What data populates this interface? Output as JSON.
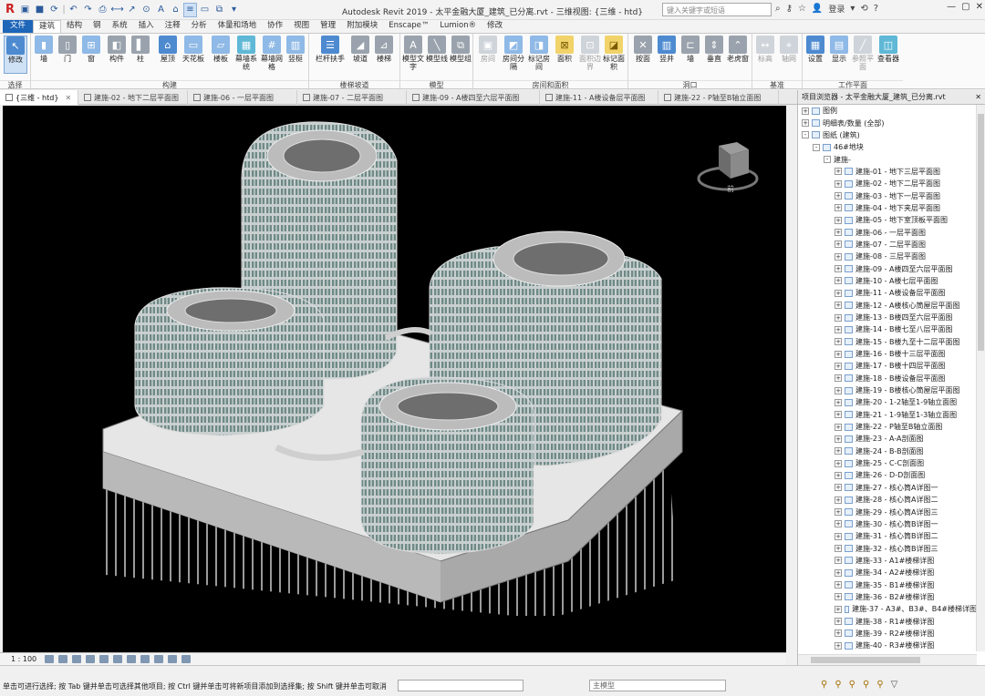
{
  "app": {
    "logo": "R",
    "window_title": "Autodesk Revit 2019 - 太平金融大厦_建筑_已分离.rvt - 三维视图: {三维 - htd}",
    "search_placeholder": "键入关键字或短语",
    "login": "登录"
  },
  "ribbon_tabs": [
    "文件",
    "建筑",
    "结构",
    "钢",
    "系统",
    "插入",
    "注释",
    "分析",
    "体量和场地",
    "协作",
    "视图",
    "管理",
    "附加模块",
    "Enscape™",
    "Lumion®",
    "修改"
  ],
  "ribbon": {
    "modify": "修改",
    "select": "选择",
    "build": {
      "label": "构建",
      "items": [
        "墙",
        "门",
        "窗",
        "构件",
        "柱",
        "屋顶",
        "天花板",
        "楼板",
        "幕墙系统",
        "幕墙网格",
        "竖梃"
      ]
    },
    "circulation": {
      "label": "楼梯坡道",
      "items": [
        "栏杆扶手",
        "坡道",
        "楼梯"
      ]
    },
    "model": {
      "label": "模型",
      "items": [
        "模型文字",
        "模型线",
        "模型组"
      ]
    },
    "room": {
      "label": "房间和面积",
      "items": [
        "房间",
        "房间分隔",
        "标记房间",
        "面积",
        "面积边界",
        "标记面积"
      ]
    },
    "opening": {
      "label": "洞口",
      "items": [
        "按面",
        "竖井",
        "墙",
        "垂直",
        "老虎窗"
      ]
    },
    "datum": {
      "label": "基准",
      "items": [
        "标高",
        "轴网"
      ]
    },
    "workplane": {
      "label": "工作平面",
      "items": [
        "设置",
        "显示",
        "参照平面",
        "查看器"
      ]
    }
  },
  "doc_tabs": [
    "{三维 - htd}",
    "建施-02 - 地下二层平面图",
    "建施-06 - 一层平面图",
    "建施-07 - 二层平面图",
    "建施-09 - A楼四至六层平面图",
    "建施-11 - A楼设备层平面图",
    "建施-22 - P轴至B轴立面图"
  ],
  "browser": {
    "title": "项目浏览器 - 太平金融大厦_建筑_已分离.rvt",
    "nodes": [
      {
        "text": "图例",
        "level": 0,
        "exp": "+"
      },
      {
        "text": "明细表/数量 (全部)",
        "level": 0,
        "exp": "+"
      },
      {
        "text": "图纸 (建筑)",
        "level": 0,
        "exp": "-"
      },
      {
        "text": "46#地块",
        "level": 1,
        "exp": "-"
      },
      {
        "text": "建施-",
        "level": 2,
        "exp": "-"
      },
      {
        "text": "建施-01 - 地下三层平面图",
        "level": 3,
        "exp": "+"
      },
      {
        "text": "建施-02 - 地下二层平面图",
        "level": 3,
        "exp": "+"
      },
      {
        "text": "建施-03 - 地下一层平面图",
        "level": 3,
        "exp": "+"
      },
      {
        "text": "建施-04 - 地下夹层平面图",
        "level": 3,
        "exp": "+"
      },
      {
        "text": "建施-05 - 地下室顶板平面图",
        "level": 3,
        "exp": "+"
      },
      {
        "text": "建施-06 - 一层平面图",
        "level": 3,
        "exp": "+"
      },
      {
        "text": "建施-07 - 二层平面图",
        "level": 3,
        "exp": "+"
      },
      {
        "text": "建施-08 - 三层平面图",
        "level": 3,
        "exp": "+"
      },
      {
        "text": "建施-09 - A楼四至六层平面图",
        "level": 3,
        "exp": "+"
      },
      {
        "text": "建施-10 - A楼七层平面图",
        "level": 3,
        "exp": "+"
      },
      {
        "text": "建施-11 - A楼设备层平面图",
        "level": 3,
        "exp": "+"
      },
      {
        "text": "建施-12 - A楼核心筒屋层平面图",
        "level": 3,
        "exp": "+"
      },
      {
        "text": "建施-13 - B楼四至六层平面图",
        "level": 3,
        "exp": "+"
      },
      {
        "text": "建施-14 - B楼七至八层平面图",
        "level": 3,
        "exp": "+"
      },
      {
        "text": "建施-15 - B楼九至十二层平面图",
        "level": 3,
        "exp": "+"
      },
      {
        "text": "建施-16 - B楼十三层平面图",
        "level": 3,
        "exp": "+"
      },
      {
        "text": "建施-17 - B楼十四层平面图",
        "level": 3,
        "exp": "+"
      },
      {
        "text": "建施-18 - B楼设备层平面图",
        "level": 3,
        "exp": "+"
      },
      {
        "text": "建施-19 - B楼核心筒屋层平面图",
        "level": 3,
        "exp": "+"
      },
      {
        "text": "建施-20 - 1-2轴至1-9轴立面图",
        "level": 3,
        "exp": "+"
      },
      {
        "text": "建施-21 - 1-9轴至1-3轴立面图",
        "level": 3,
        "exp": "+"
      },
      {
        "text": "建施-22 - P轴至B轴立面图",
        "level": 3,
        "exp": "+"
      },
      {
        "text": "建施-23 - A-A剖面图",
        "level": 3,
        "exp": "+"
      },
      {
        "text": "建施-24 - B-B剖面图",
        "level": 3,
        "exp": "+"
      },
      {
        "text": "建施-25 - C-C剖面图",
        "level": 3,
        "exp": "+"
      },
      {
        "text": "建施-26 - D-D剖面图",
        "level": 3,
        "exp": "+"
      },
      {
        "text": "建施-27 - 核心筒A详图一",
        "level": 3,
        "exp": "+"
      },
      {
        "text": "建施-28 - 核心筒A详图二",
        "level": 3,
        "exp": "+"
      },
      {
        "text": "建施-29 - 核心筒A详图三",
        "level": 3,
        "exp": "+"
      },
      {
        "text": "建施-30 - 核心筒B详图一",
        "level": 3,
        "exp": "+"
      },
      {
        "text": "建施-31 - 核心筒B详图二",
        "level": 3,
        "exp": "+"
      },
      {
        "text": "建施-32 - 核心筒B详图三",
        "level": 3,
        "exp": "+"
      },
      {
        "text": "建施-33 - A1#楼梯详图",
        "level": 3,
        "exp": "+"
      },
      {
        "text": "建施-34 - A2#楼梯详图",
        "level": 3,
        "exp": "+"
      },
      {
        "text": "建施-35 - B1#楼梯详图",
        "level": 3,
        "exp": "+"
      },
      {
        "text": "建施-36 - B2#楼梯详图",
        "level": 3,
        "exp": "+"
      },
      {
        "text": "建施-37 - A3#、B3#、B4#楼梯详图",
        "level": 3,
        "exp": "+"
      },
      {
        "text": "建施-38 - R1#楼梯详图",
        "level": 3,
        "exp": "+"
      },
      {
        "text": "建施-39 - R2#楼梯详图",
        "level": 3,
        "exp": "+"
      },
      {
        "text": "建施-40 - R3#楼梯详图",
        "level": 3,
        "exp": "+"
      }
    ]
  },
  "viewbar": {
    "scale": "1 : 100"
  },
  "status": {
    "text": "单击可进行选择; 按 Tab 键并单击可选择其他项目; 按 Ctrl 键并单击可将新项目添加到选择集; 按 Shift 键并单击可取消",
    "model": "主模型"
  },
  "viewcube": {
    "label": "前"
  }
}
